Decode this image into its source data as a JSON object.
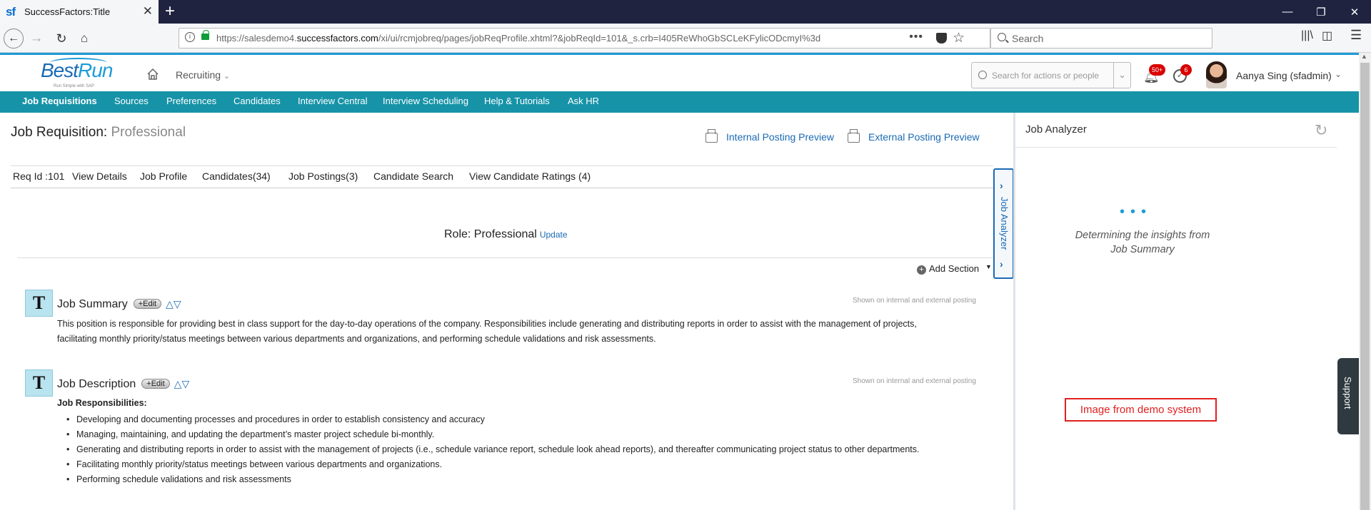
{
  "browser": {
    "tab_title": "SuccessFactors:Title",
    "favicon": "sf",
    "url_prefix": "https://salesdemo4.",
    "url_domain": "successfactors.com",
    "url_rest": "/xi/ui/rcmjobreq/pages/jobReqProfile.xhtml?&jobReqId=101&_s.crb=I405ReWhoGbSCLeKFylicODcmyI%3d",
    "search_placeholder": "Search"
  },
  "header": {
    "logo_best": "Best",
    "logo_run": "Run",
    "logo_sub": "Run Simple with SAP",
    "module": "Recruiting",
    "search_placeholder": "Search for actions or people",
    "notification_count": "50+",
    "todo_count": "6",
    "user_name": "Aanya Sing (sfadmin)"
  },
  "nav": {
    "items": [
      "Job Requisitions",
      "Sources",
      "Preferences",
      "Candidates",
      "Interview Central",
      "Interview Scheduling",
      "Help & Tutorials",
      "Ask HR"
    ],
    "active": "Job Requisitions"
  },
  "page": {
    "title_prefix": "Job Requisition:",
    "title_role": "Professional",
    "internal_preview": "Internal Posting Preview",
    "external_preview": "External Posting Preview",
    "subtabs": [
      "Req Id :101",
      "View Details",
      "Job Profile",
      "Candidates(34)",
      "Job Postings(3)",
      "Candidate Search",
      "View Candidate Ratings (4)"
    ],
    "role_heading": "Role: Professional",
    "update_link": "Update",
    "add_section": "Add Section",
    "collapse_tab_label": "Job Analyzer"
  },
  "sections": {
    "summary": {
      "title": "Job Summary",
      "edit": "+Edit",
      "shown": "Shown on internal and external posting",
      "body_line1": "This position is responsible for providing best in class support for the day-to-day operations of the company. Responsibilities include generating and distributing reports in order to assist with the management of projects,",
      "body_line2": "facilitating monthly priority/status meetings between various departments and organizations, and performing schedule validations and risk assessments."
    },
    "description": {
      "title": "Job Description",
      "edit": "+Edit",
      "shown": "Shown on internal and external posting",
      "subhead": "Job Responsibilities:",
      "bullets": [
        "Developing and documenting processes and procedures in order to establish consistency and accuracy",
        "Managing, maintaining, and updating the department’s master project schedule bi-monthly.",
        "Generating and distributing reports in order to assist with the management of projects (i.e., schedule variance report, schedule look ahead reports), and thereafter communicating project status to other departments.",
        "Facilitating monthly priority/status meetings between various departments and organizations.",
        "Performing schedule validations and risk assessments"
      ]
    }
  },
  "analyzer": {
    "title": "Job Analyzer",
    "insight_line1": "Determining the insights from",
    "insight_line2": "Job Summary"
  },
  "overlay": {
    "demo_label": "Image from demo system",
    "support": "Support"
  }
}
